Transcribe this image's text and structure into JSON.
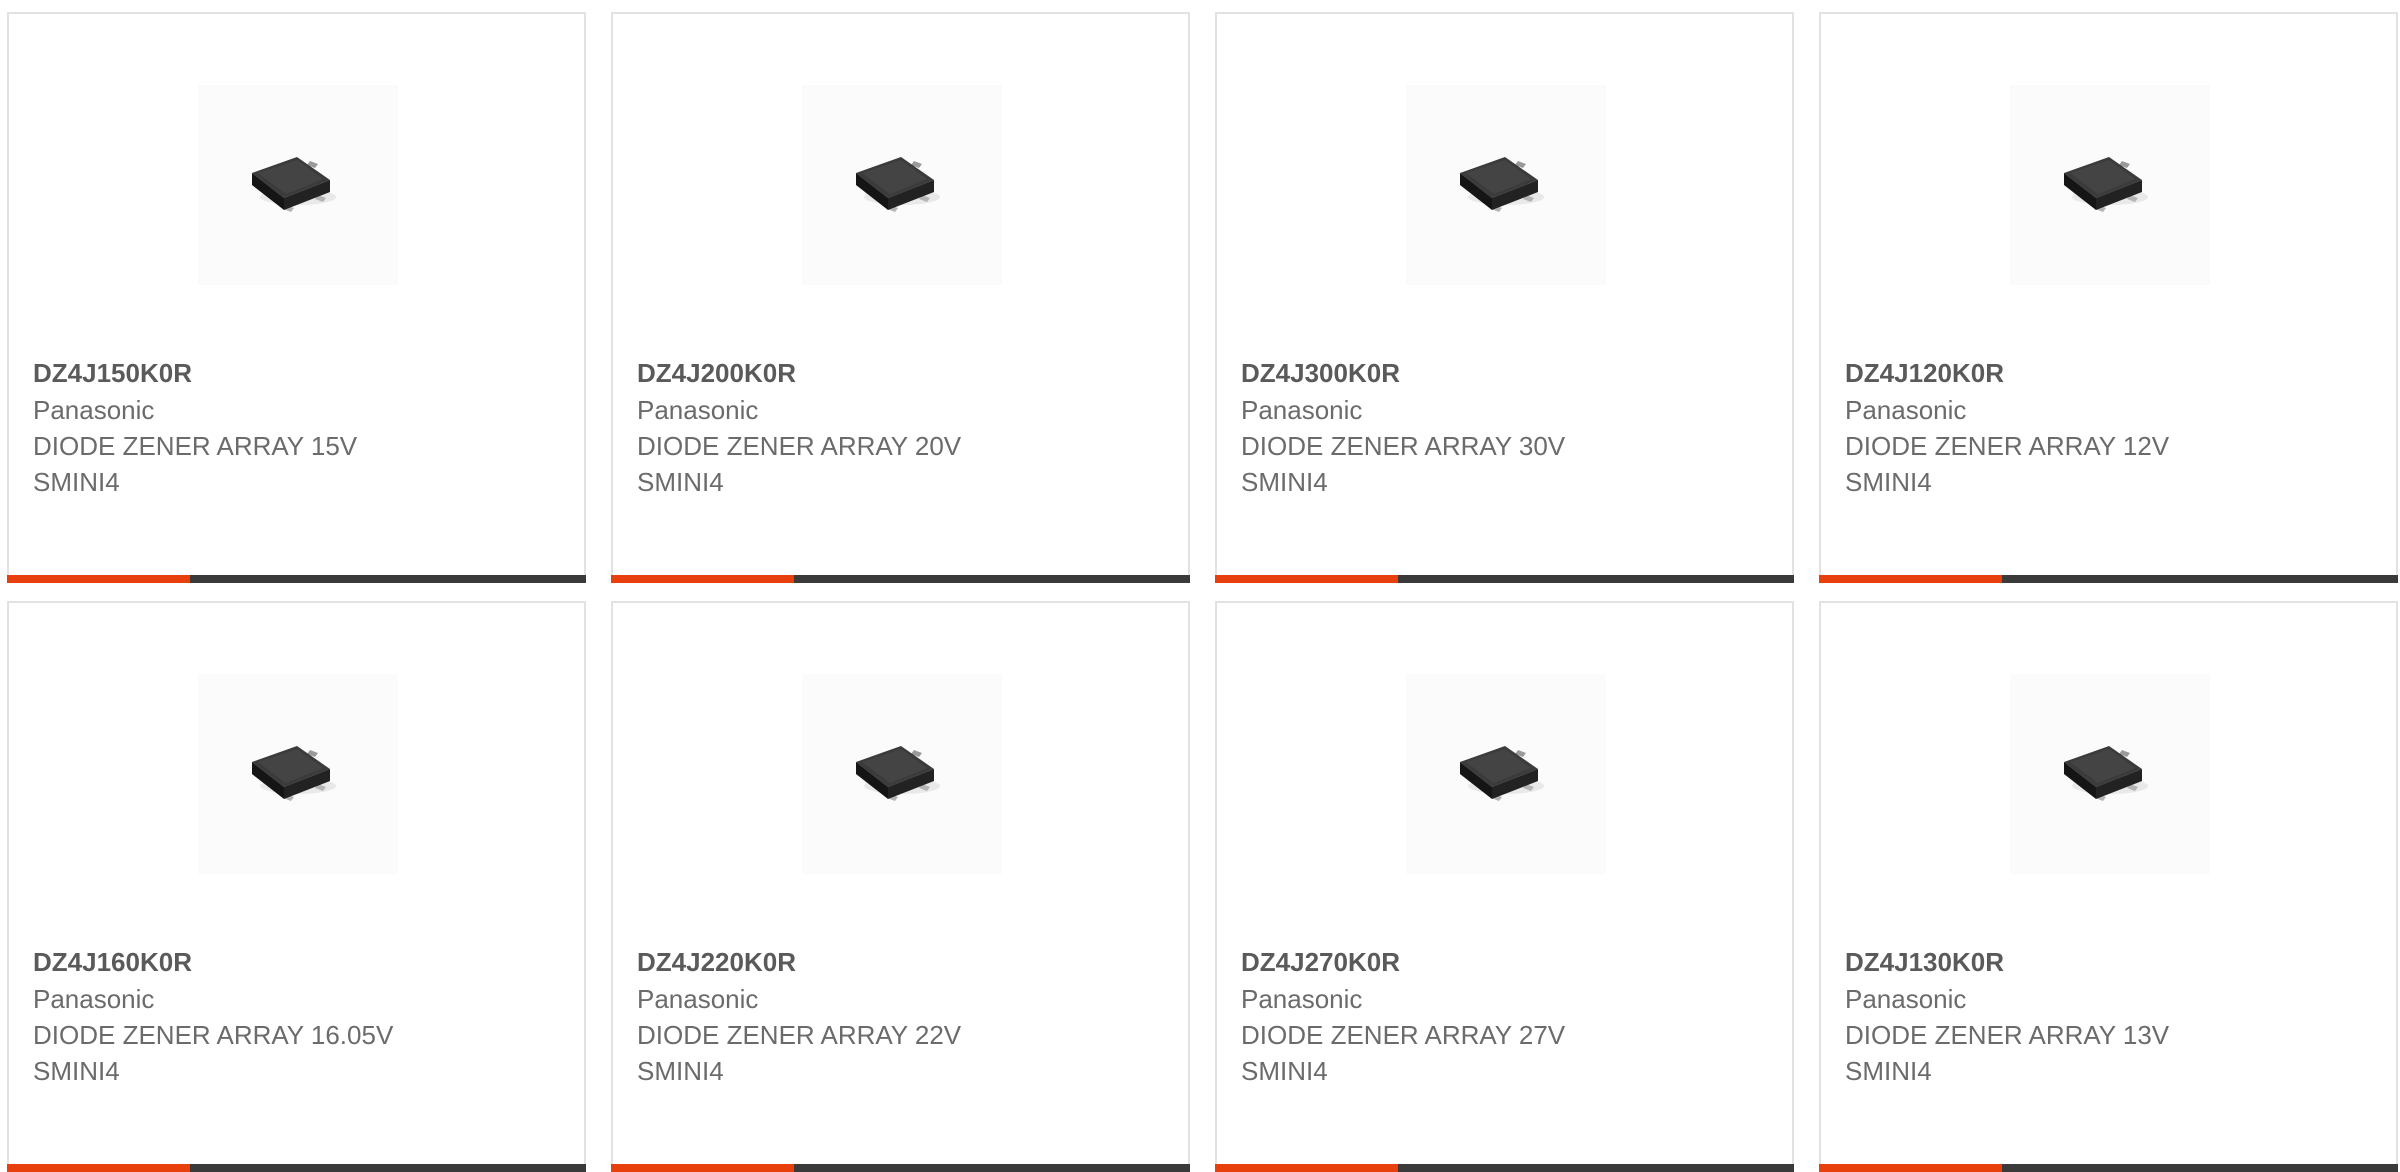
{
  "accent_color": "#e8400c",
  "bar_color": "#3a3a3a",
  "products": [
    {
      "part_number": "DZ4J150K0R",
      "manufacturer": "Panasonic",
      "description": "DIODE ZENER ARRAY 15V",
      "package": "SMINI4",
      "image_icon": "smd-diode-package-icon"
    },
    {
      "part_number": "DZ4J200K0R",
      "manufacturer": "Panasonic",
      "description": "DIODE ZENER ARRAY 20V",
      "package": "SMINI4",
      "image_icon": "smd-diode-package-icon"
    },
    {
      "part_number": "DZ4J300K0R",
      "manufacturer": "Panasonic",
      "description": "DIODE ZENER ARRAY 30V",
      "package": "SMINI4",
      "image_icon": "smd-diode-package-icon"
    },
    {
      "part_number": "DZ4J120K0R",
      "manufacturer": "Panasonic",
      "description": "DIODE ZENER ARRAY 12V",
      "package": "SMINI4",
      "image_icon": "smd-diode-package-icon"
    },
    {
      "part_number": "DZ4J160K0R",
      "manufacturer": "Panasonic",
      "description": "DIODE ZENER ARRAY 16.05V",
      "package": "SMINI4",
      "image_icon": "smd-diode-package-icon"
    },
    {
      "part_number": "DZ4J220K0R",
      "manufacturer": "Panasonic",
      "description": "DIODE ZENER ARRAY 22V",
      "package": "SMINI4",
      "image_icon": "smd-diode-package-icon"
    },
    {
      "part_number": "DZ4J270K0R",
      "manufacturer": "Panasonic",
      "description": "DIODE ZENER ARRAY 27V",
      "package": "SMINI4",
      "image_icon": "smd-diode-package-icon"
    },
    {
      "part_number": "DZ4J130K0R",
      "manufacturer": "Panasonic",
      "description": "DIODE ZENER ARRAY 13V",
      "package": "SMINI4",
      "image_icon": "smd-diode-package-icon"
    }
  ]
}
